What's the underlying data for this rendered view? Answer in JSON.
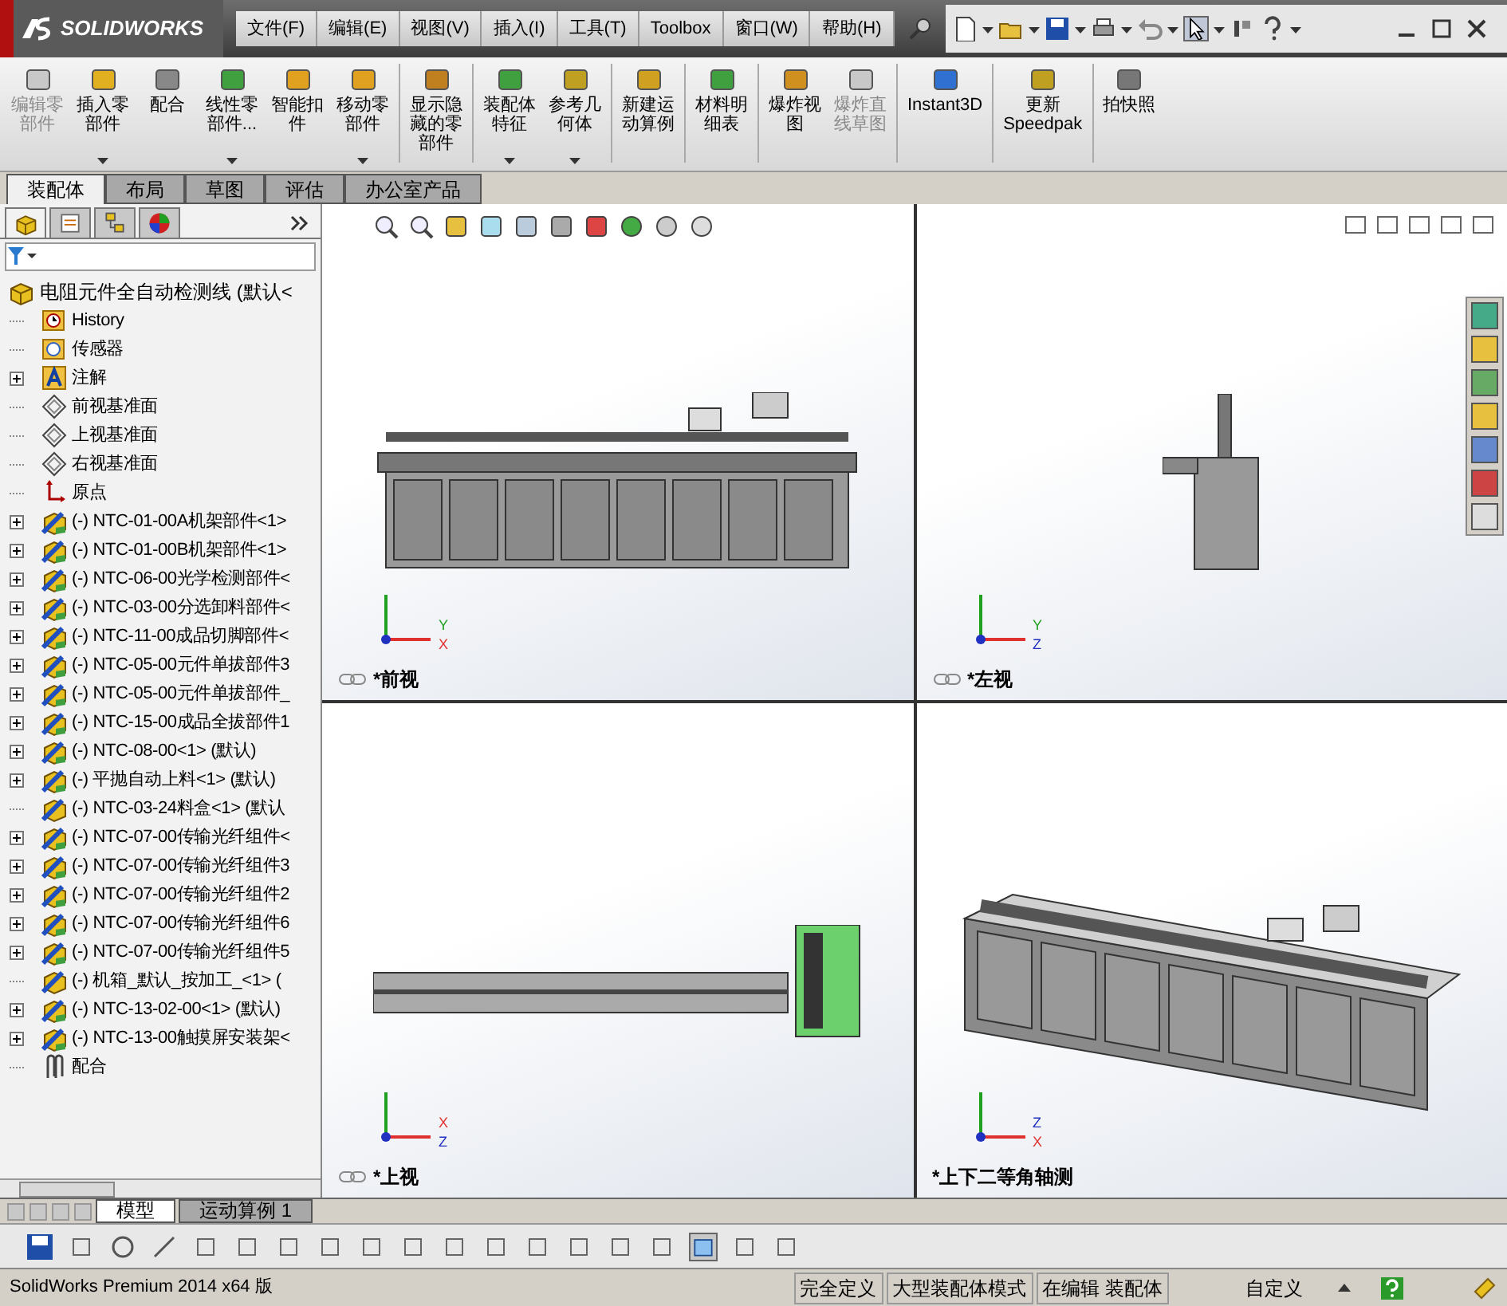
{
  "app": {
    "logo": "SOLIDWORKS",
    "menus": [
      "文件(F)",
      "编辑(E)",
      "视图(V)",
      "插入(I)",
      "工具(T)",
      "Toolbox",
      "窗口(W)",
      "帮助(H)"
    ]
  },
  "ribbon": [
    {
      "label_lines": [
        "编辑零",
        "部件"
      ],
      "disabled": true,
      "dropdown": false
    },
    {
      "label_lines": [
        "插入零",
        "部件"
      ],
      "disabled": false,
      "dropdown": true
    },
    {
      "label_lines": [
        "配合"
      ],
      "disabled": false,
      "dropdown": false
    },
    {
      "label_lines": [
        "线性零",
        "部件..."
      ],
      "disabled": false,
      "dropdown": true
    },
    {
      "label_lines": [
        "智能扣",
        "件"
      ],
      "disabled": false,
      "dropdown": false
    },
    {
      "label_lines": [
        "移动零",
        "部件"
      ],
      "disabled": false,
      "dropdown": true
    },
    {
      "label_lines": [
        "显示隐",
        "藏的零",
        "部件"
      ],
      "disabled": false,
      "dropdown": false
    },
    {
      "label_lines": [
        "装配体",
        "特征"
      ],
      "disabled": false,
      "dropdown": true
    },
    {
      "label_lines": [
        "参考几",
        "何体"
      ],
      "disabled": false,
      "dropdown": true
    },
    {
      "label_lines": [
        "新建运",
        "动算例"
      ],
      "disabled": false,
      "dropdown": false
    },
    {
      "label_lines": [
        "材料明",
        "细表"
      ],
      "disabled": false,
      "dropdown": false
    },
    {
      "label_lines": [
        "爆炸视",
        "图"
      ],
      "disabled": false,
      "dropdown": false
    },
    {
      "label_lines": [
        "爆炸直",
        "线草图"
      ],
      "disabled": true,
      "dropdown": false
    },
    {
      "label_lines": [
        "Instant3D"
      ],
      "disabled": false,
      "dropdown": false
    },
    {
      "label_lines": [
        "更新",
        "Speedpak"
      ],
      "disabled": false,
      "dropdown": false
    },
    {
      "label_lines": [
        "拍快照"
      ],
      "disabled": false,
      "dropdown": false
    }
  ],
  "command_tabs": [
    {
      "label": "装配体",
      "selected": true
    },
    {
      "label": "布局",
      "selected": false
    },
    {
      "label": "草图",
      "selected": false
    },
    {
      "label": "评估",
      "selected": false
    },
    {
      "label": "办公室产品",
      "selected": false
    }
  ],
  "tree": {
    "root": "电阻元件全自动检测线 (默认<",
    "items": [
      {
        "label": "History",
        "kind": "history",
        "expandable": false
      },
      {
        "label": "传感器",
        "kind": "sensor",
        "expandable": false
      },
      {
        "label": "注解",
        "kind": "annotation",
        "expandable": true
      },
      {
        "label": "前视基准面",
        "kind": "plane",
        "expandable": false
      },
      {
        "label": "上视基准面",
        "kind": "plane",
        "expandable": false
      },
      {
        "label": "右视基准面",
        "kind": "plane",
        "expandable": false
      },
      {
        "label": "原点",
        "kind": "origin",
        "expandable": false
      },
      {
        "label": "(-) NTC-01-00A机架部件<1>",
        "kind": "assembly",
        "expandable": true
      },
      {
        "label": "(-) NTC-01-00B机架部件<1>",
        "kind": "assembly",
        "expandable": true
      },
      {
        "label": "(-) NTC-06-00光学检测部件<",
        "kind": "assembly",
        "expandable": true
      },
      {
        "label": "(-) NTC-03-00分选卸料部件<",
        "kind": "assembly",
        "expandable": true
      },
      {
        "label": "(-) NTC-11-00成品切脚部件<",
        "kind": "assembly",
        "expandable": true
      },
      {
        "label": "(-) NTC-05-00元件单拔部件3",
        "kind": "assembly",
        "expandable": true
      },
      {
        "label": "(-) NTC-05-00元件单拔部件_",
        "kind": "assembly",
        "expandable": true
      },
      {
        "label": "(-) NTC-15-00成品全拔部件1",
        "kind": "assembly",
        "expandable": true
      },
      {
        "label": "(-) NTC-08-00<1> (默认)",
        "kind": "assembly",
        "expandable": true
      },
      {
        "label": "(-) 平抛自动上料<1> (默认)",
        "kind": "assembly",
        "expandable": true
      },
      {
        "label": "(-) NTC-03-24料盒<1> (默认",
        "kind": "part",
        "expandable": false
      },
      {
        "label": "(-) NTC-07-00传输光纤组件<",
        "kind": "assembly",
        "expandable": true
      },
      {
        "label": "(-) NTC-07-00传输光纤组件3",
        "kind": "assembly",
        "expandable": true
      },
      {
        "label": "(-) NTC-07-00传输光纤组件2",
        "kind": "assembly",
        "expandable": true
      },
      {
        "label": "(-) NTC-07-00传输光纤组件6",
        "kind": "assembly",
        "expandable": true
      },
      {
        "label": "(-) NTC-07-00传输光纤组件5",
        "kind": "assembly",
        "expandable": true
      },
      {
        "label": "(-) 机箱_默认_按加工_<1> (",
        "kind": "part",
        "expandable": false
      },
      {
        "label": "(-) NTC-13-02-00<1> (默认)",
        "kind": "assembly",
        "expandable": true
      },
      {
        "label": "(-) NTC-13-00触摸屏安装架<",
        "kind": "assembly",
        "expandable": true
      },
      {
        "label": "配合",
        "kind": "mates",
        "expandable": false
      }
    ]
  },
  "viewports": [
    {
      "label": "*前视",
      "kind": "front",
      "axes": [
        "Y",
        "X"
      ]
    },
    {
      "label": "*左视",
      "kind": "left",
      "axes": [
        "Y",
        "Z"
      ]
    },
    {
      "label": "*上视",
      "kind": "top",
      "axes": [
        "X",
        "Z"
      ]
    },
    {
      "label": "*上下二等角轴测",
      "kind": "iso",
      "axes": [
        "Z",
        "X"
      ]
    }
  ],
  "bottom_tabs": [
    {
      "label": "模型",
      "selected": true
    },
    {
      "label": "运动算例 1",
      "selected": false
    }
  ],
  "status_bar": {
    "product": "SolidWorks Premium 2014 x64 版",
    "segments": [
      "完全定义",
      "大型装配体模式",
      "在编辑 装配体"
    ],
    "units": "自定义"
  }
}
